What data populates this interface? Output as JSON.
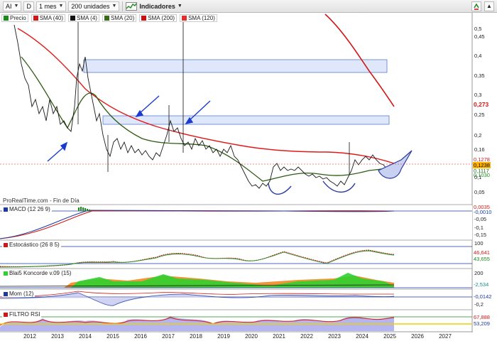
{
  "toolbar": {
    "symbol": "AI",
    "period_badge": "D",
    "interval": "1 mes",
    "units": "200 unidades",
    "indicators_label": "Indicadores"
  },
  "legend": [
    {
      "label": "Precio",
      "color": "#1c8a1c"
    },
    {
      "label": "SMA (40)",
      "color": "#d01818"
    },
    {
      "label": "SMA (4)",
      "color": "#111111"
    },
    {
      "label": "SMA (20)",
      "color": "#3a6a1a"
    },
    {
      "label": "SMA (200)",
      "color": "#cc1010"
    },
    {
      "label": "SMA (120)",
      "color": "#e23030"
    }
  ],
  "provider_text": "ProRealTime.com - Fin de Día",
  "panels": {
    "macd": "MACD (12 26 9)",
    "stoch": "Estocástico (26 8 5)",
    "koncorde": "Blai5 Koncorde v.09 (15)",
    "mom": "Mom (12)",
    "rsi": "FILTRO RSI"
  },
  "price_axis": {
    "ticks": [
      "0,5",
      "0,45",
      "0,4",
      "0,35",
      "0,3",
      "0,25",
      "0,2",
      "0,16",
      "0,1",
      "0,05"
    ],
    "tags": [
      {
        "text": "0,273",
        "bg": "#ffffff",
        "fg": "#d01818"
      },
      {
        "text": "0,1278",
        "bg": "#ffffff",
        "fg": "#d01818"
      },
      {
        "text": "0,1238",
        "bg": "#ffb400",
        "fg": "#000000"
      },
      {
        "text": "0,1117",
        "bg": "#ffffff",
        "fg": "#1c6a1c"
      },
      {
        "text": "0,1030",
        "bg": "#ffffff",
        "fg": "#1c8a1c"
      }
    ]
  },
  "macd_axis": {
    "ticks": [
      "-0,05",
      "-0,1",
      "-0,15"
    ],
    "tags": [
      {
        "text": "0,0035",
        "fg": "#d01818"
      },
      {
        "text": "-0,0010",
        "fg": "#1a3aa0"
      }
    ]
  },
  "stoch_axis": {
    "ticks": [
      "100"
    ],
    "tags": [
      {
        "text": "46,641",
        "fg": "#d01818"
      },
      {
        "text": "43,655",
        "fg": "#1c8a1c"
      }
    ]
  },
  "koncorde_axis": {
    "ticks": [
      "200"
    ],
    "tags": [
      {
        "text": "-2,534",
        "fg": "#1a8a8a"
      }
    ]
  },
  "mom_axis": {
    "ticks": [
      "-0,2"
    ],
    "tags": [
      {
        "text": "-0,0142",
        "fg": "#1a3aa0"
      }
    ]
  },
  "rsi_axis": {
    "tags": [
      {
        "text": "67,888",
        "fg": "#d01818"
      },
      {
        "text": "53,209",
        "fg": "#1a3aa0"
      }
    ]
  },
  "years": [
    "2012",
    "2013",
    "2014",
    "2015",
    "2016",
    "2017",
    "2018",
    "2019",
    "2020",
    "2021",
    "2022",
    "2023",
    "2024",
    "2025",
    "2026",
    "2027"
  ]
}
